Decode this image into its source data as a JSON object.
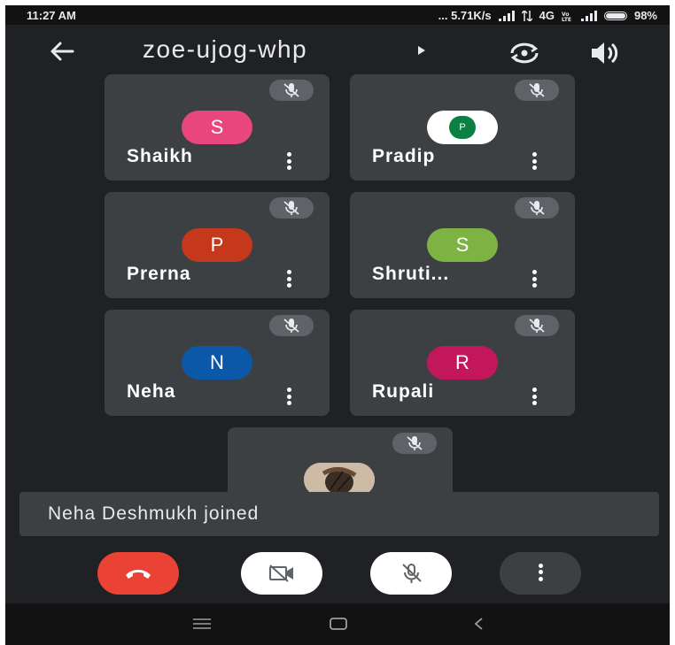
{
  "status_bar": {
    "time": "11:27 AM",
    "network_speed": "... 5.71K/s",
    "network_type": "4G",
    "battery": "98%"
  },
  "header": {
    "meeting_code": "zoe-ujog-whp",
    "icons": [
      "arrow-left-icon",
      "switch-camera-icon",
      "speaker-icon"
    ]
  },
  "participants": [
    {
      "name": "Shaikh",
      "initial": "S",
      "color": "#e8467c",
      "muted": true
    },
    {
      "name": "Pradip",
      "initial": "P",
      "color": "#0b8043",
      "muted": true
    },
    {
      "name": "Prerna",
      "initial": "P",
      "color": "#c5381c",
      "muted": true
    },
    {
      "name": "Shruti...",
      "initial": "S",
      "color": "#7cb342",
      "muted": true
    },
    {
      "name": "Neha",
      "initial": "N",
      "color": "#0b57a8",
      "muted": true
    },
    {
      "name": "Rupali",
      "initial": "R",
      "color": "#c2185b",
      "muted": true
    },
    {
      "name": "",
      "initial": "",
      "photo": true,
      "muted": true
    }
  ],
  "toast": {
    "message": "Neha Deshmukh joined"
  },
  "controls": {
    "end_call_color": "#ea4335",
    "camera_state": "off",
    "mic_state": "off"
  }
}
